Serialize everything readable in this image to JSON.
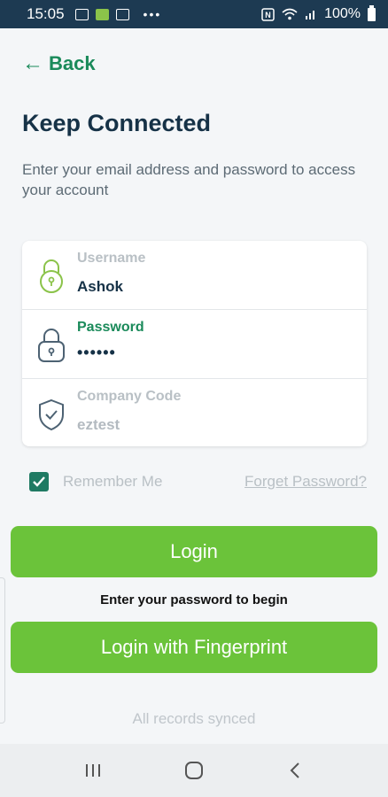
{
  "status_bar": {
    "time": "15:05",
    "battery": "100%",
    "icons": [
      "image-icon",
      "app-icon",
      "chat-icon",
      "more-dots-icon",
      "nfc-icon",
      "wifi-icon",
      "signal-icon",
      "battery-icon"
    ]
  },
  "nav": {
    "back_label": "Back",
    "back_icon": "arrow-left-icon"
  },
  "header": {
    "title": "Keep Connected",
    "subtitle": "Enter your email address and password to access your account"
  },
  "form": {
    "fields": [
      {
        "label": "Username",
        "value": "Ashok",
        "icon": "lock-keyhole-icon",
        "active": false
      },
      {
        "label": "Password",
        "value": "••••••",
        "icon": "padlock-icon",
        "active": true
      },
      {
        "label": "Company Code",
        "value": "eztest",
        "icon": "shield-check-icon",
        "active": false
      }
    ],
    "remember_label": "Remember Me",
    "remember_checked": true,
    "forgot_label": "Forget Password?"
  },
  "actions": {
    "login_label": "Login",
    "hint": "Enter your password to begin",
    "fingerprint_label": "Login with Fingerprint"
  },
  "footer": {
    "sync_status": "All records synced"
  },
  "colors": {
    "accent_green": "#6bc33a",
    "dark_green": "#1a8a5a",
    "title_navy": "#163247",
    "status_bar": "#1d3a52"
  }
}
